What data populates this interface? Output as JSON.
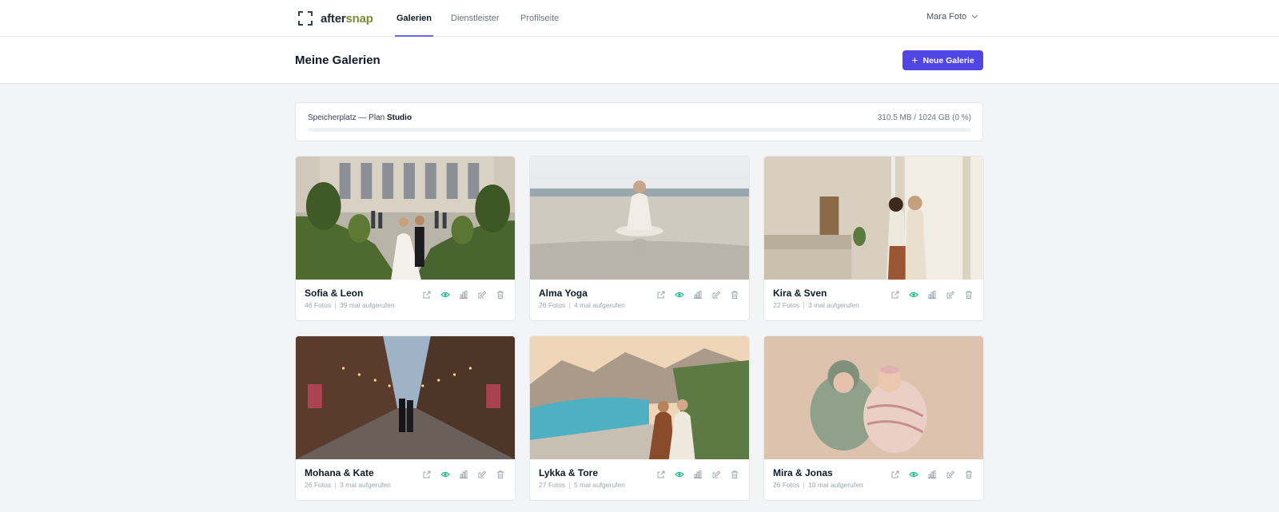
{
  "app": {
    "logo_part1": "after",
    "logo_part2": "snap",
    "accent": "#4f46e5",
    "logo_accent": "#7c8b3a"
  },
  "nav": {
    "tabs": [
      {
        "label": "Galerien",
        "active": true
      },
      {
        "label": "Dienstleister",
        "active": false
      },
      {
        "label": "Profilseite",
        "active": false
      }
    ],
    "user": "Mara Foto"
  },
  "header": {
    "title": "Meine Galerien",
    "new_button": "Neue Galerie",
    "new_button_icon": "plus-icon"
  },
  "storage": {
    "label": "Speicherplatz — Plan",
    "plan": "Studio",
    "value": "310.5 MB / 1024 GB (0 %)",
    "percent": 0
  },
  "galleries": [
    {
      "title": "Sofia & Leon",
      "photos": "46 Fotos",
      "views": "39 mal aufgerufen"
    },
    {
      "title": "Alma Yoga",
      "photos": "26 Fotos",
      "views": "4 mal aufgerufen"
    },
    {
      "title": "Kira & Sven",
      "photos": "22 Fotos",
      "views": "3 mal aufgerufen"
    },
    {
      "title": "Mohana & Kate",
      "photos": "26 Fotos",
      "views": "3 mal aufgerufen"
    },
    {
      "title": "Lykka & Tore",
      "photos": "27 Fotos",
      "views": "5 mal aufgerufen"
    },
    {
      "title": "Mira & Jonas",
      "photos": "26 Fotos",
      "views": "10 mal aufgerufen"
    }
  ],
  "card_actions": [
    "external-link-icon",
    "eye-icon",
    "bar-chart-icon",
    "edit-icon",
    "trash-icon"
  ],
  "colors": {
    "eye_active": "#10b981",
    "icon_muted": "#9ca3af"
  }
}
